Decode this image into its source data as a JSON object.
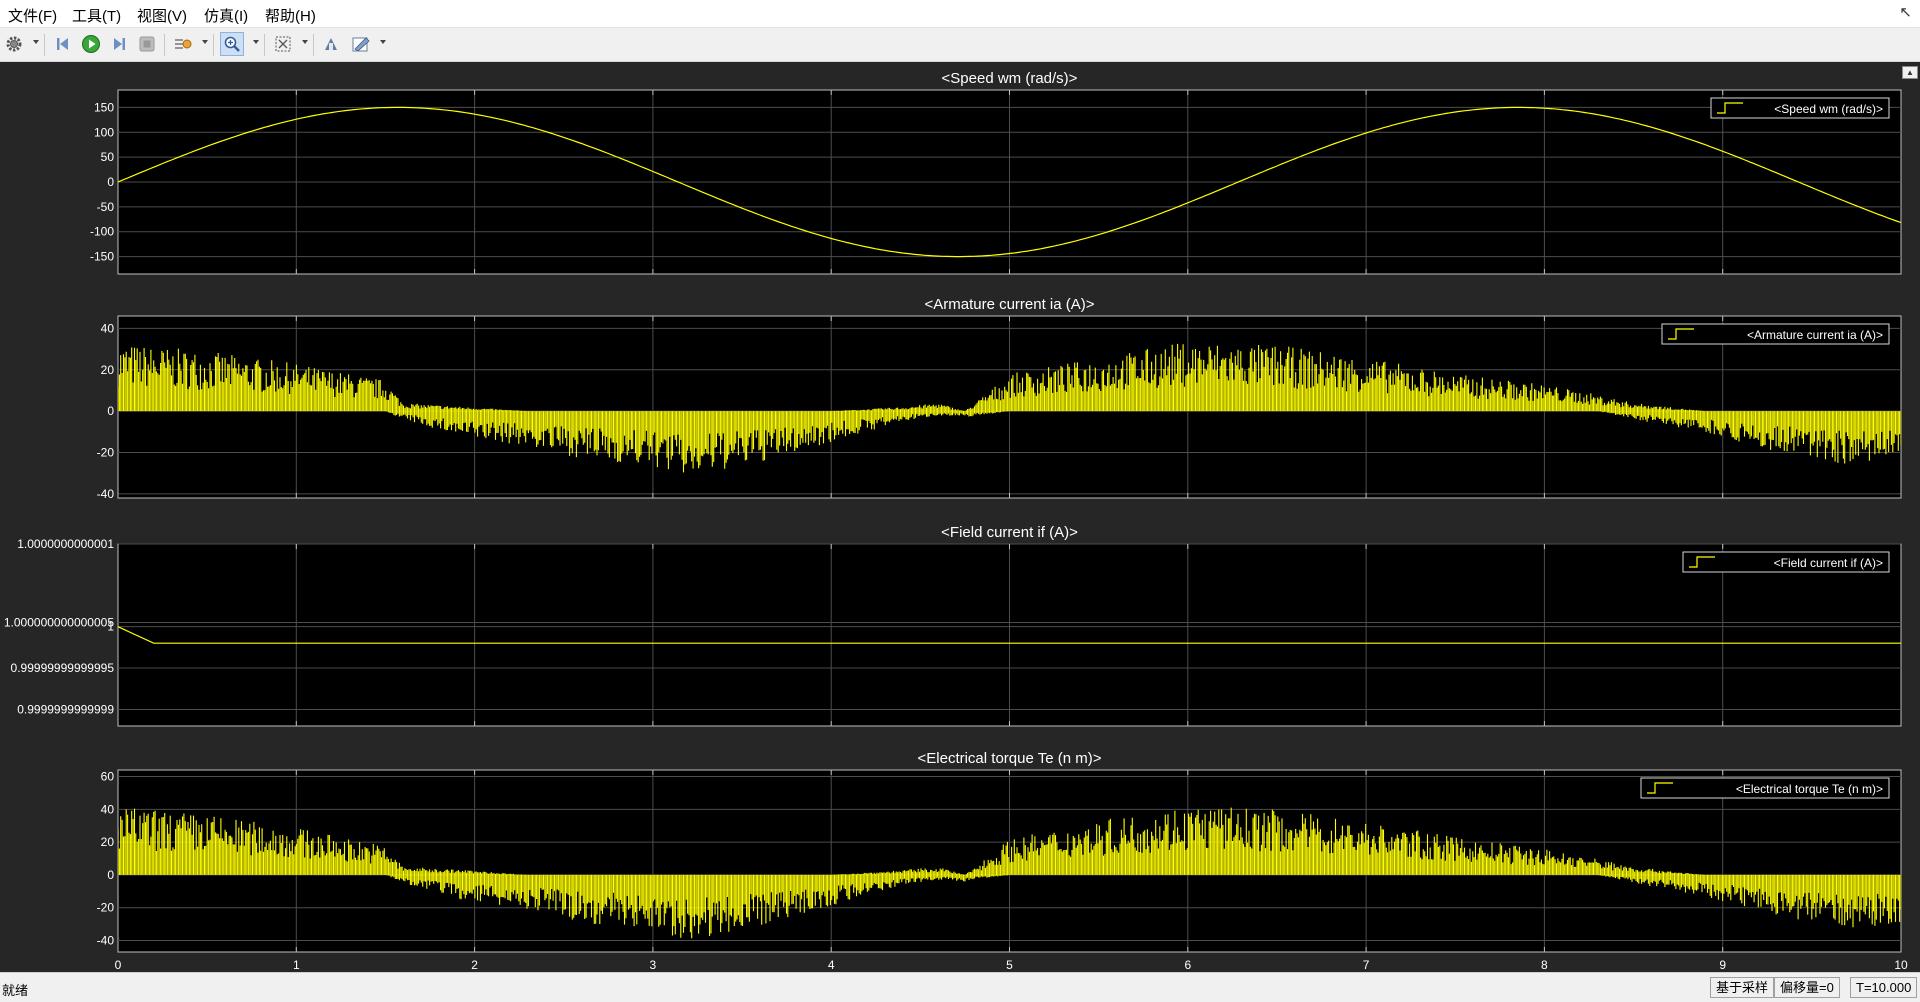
{
  "menubar": {
    "items": [
      "文件(F)",
      "工具(T)",
      "视图(V)",
      "仿真(I)",
      "帮助(H)"
    ]
  },
  "toolbar": {
    "icons": [
      "gear-icon",
      "step-back-icon",
      "run-icon",
      "step-forward-icon",
      "stop-icon",
      "signal-trigger-icon",
      "zoom-icon",
      "fit-to-view-icon",
      "highlight-block-icon",
      "style-icon"
    ]
  },
  "status": {
    "ready": "就绪",
    "sample_based": "基于采样",
    "offset": "偏移量=0",
    "time": "T=10.000"
  },
  "colors": {
    "plot_bg": "#000000",
    "figure_bg": "#262626",
    "trace": "#ffff00",
    "grid": "#4d4d4d",
    "text": "#ffffff"
  },
  "chart_data": [
    {
      "type": "line",
      "title": "<Speed wm (rad/s)>",
      "legend": "<Speed wm (rad/s)>",
      "legend_position": "top-right",
      "xlim": [
        0,
        10
      ],
      "ylim": [
        -185,
        185
      ],
      "yticks": [
        -150,
        -100,
        -50,
        0,
        50,
        100,
        150
      ],
      "ytick_labels": [
        "-150",
        "-100",
        "-50",
        "0",
        "50",
        "100",
        "150"
      ],
      "grid": true,
      "series": [
        {
          "x": [
            0,
            0.5,
            1,
            1.5,
            1.57,
            2,
            2.5,
            3,
            3.5,
            4,
            4.5,
            4.71,
            5,
            5.5,
            6,
            6.5,
            7,
            7.5,
            7.85,
            8,
            8.5,
            9,
            9.5,
            10
          ],
          "y": [
            0,
            72,
            126,
            150,
            150,
            136,
            90,
            21,
            -53,
            -114,
            -147,
            -150,
            -144,
            -106,
            -42,
            32,
            99,
            142,
            150,
            148,
            119,
            62,
            -11,
            -82
          ]
        }
      ]
    },
    {
      "type": "line",
      "title": "<Armature current ia (A)>",
      "legend": "<Armature current ia (A)>",
      "legend_position": "top-right",
      "xlim": [
        0,
        10
      ],
      "ylim": [
        -42,
        46
      ],
      "yticks": [
        -40,
        -20,
        0,
        20,
        40
      ],
      "ytick_labels": [
        "-40",
        "-20",
        "0",
        "20",
        "40"
      ],
      "grid": true,
      "envelope": {
        "x": [
          0,
          0.5,
          1,
          1.5,
          1.6,
          1.95,
          2.3,
          2.6,
          3,
          3.2,
          3.6,
          4,
          4.4,
          4.6,
          4.75,
          5,
          5.5,
          6,
          6.5,
          7,
          7.5,
          8,
          8.3,
          8.5,
          8.9,
          9.3,
          9.7,
          10
        ],
        "upper": [
          33,
          29,
          23,
          15,
          4,
          2,
          0,
          0,
          0,
          0,
          0,
          0,
          2,
          4,
          0,
          18,
          26,
          34,
          32,
          26,
          18,
          13,
          8,
          4,
          0,
          0,
          0,
          0
        ],
        "lower": [
          0,
          0,
          0,
          0,
          -4,
          -13,
          -17,
          -23,
          -27,
          -32,
          -25,
          -15,
          -5,
          -2,
          -3,
          0,
          0,
          0,
          0,
          0,
          0,
          0,
          0,
          -4,
          -10,
          -20,
          -26,
          -24
        ]
      }
    },
    {
      "type": "line",
      "title": "<Field current if (A)>",
      "legend": "<Field current if (A)>",
      "legend_position": "top-right",
      "xlim": [
        0,
        10
      ],
      "ylim": [
        0.99999999999988,
        1.0000000000001
      ],
      "yticks": [
        0.9999999999999,
        0.99999999999995,
        1,
        1.000000000000005,
        1.0000000000001
      ],
      "ytick_labels": [
        "0.9999999999999",
        "0.99999999999995",
        "1",
        "1.000000000000005",
        "1.0000000000001"
      ],
      "grid": true,
      "series": [
        {
          "x": [
            0,
            0.2,
            10
          ],
          "y": [
            1,
            0.99999999999998,
            0.99999999999998
          ]
        }
      ]
    },
    {
      "type": "line",
      "title": "<Electrical torque Te (n m)>",
      "legend": "<Electrical torque Te (n m)>",
      "legend_position": "top-right",
      "xlim": [
        0,
        10
      ],
      "ylim": [
        -47,
        64
      ],
      "yticks": [
        -40,
        -20,
        0,
        20,
        40,
        60
      ],
      "ytick_labels": [
        "-40",
        "-20",
        "0",
        "20",
        "40",
        "60"
      ],
      "xticks": [
        0,
        1,
        2,
        3,
        4,
        5,
        6,
        7,
        8,
        9,
        10
      ],
      "xtick_labels": [
        "0",
        "1",
        "2",
        "3",
        "4",
        "5",
        "6",
        "7",
        "8",
        "9",
        "10"
      ],
      "grid": true,
      "envelope": {
        "x": [
          0,
          0.5,
          1,
          1.5,
          1.6,
          1.95,
          2.3,
          2.6,
          3,
          3.2,
          3.6,
          4,
          4.4,
          4.6,
          4.75,
          5,
          5.5,
          6,
          6.5,
          7,
          7.5,
          8,
          8.3,
          8.5,
          8.9,
          9.3,
          9.7,
          10
        ],
        "upper": [
          42,
          37,
          29,
          18,
          5,
          3,
          0,
          0,
          0,
          0,
          0,
          0,
          3,
          5,
          0,
          22,
          33,
          43,
          40,
          33,
          23,
          16,
          10,
          5,
          0,
          0,
          0,
          0
        ],
        "lower": [
          0,
          0,
          0,
          0,
          -5,
          -16,
          -21,
          -29,
          -34,
          -40,
          -31,
          -19,
          -6,
          -3,
          -4,
          0,
          0,
          0,
          0,
          0,
          0,
          0,
          0,
          -5,
          -13,
          -25,
          -33,
          -30
        ]
      }
    }
  ]
}
